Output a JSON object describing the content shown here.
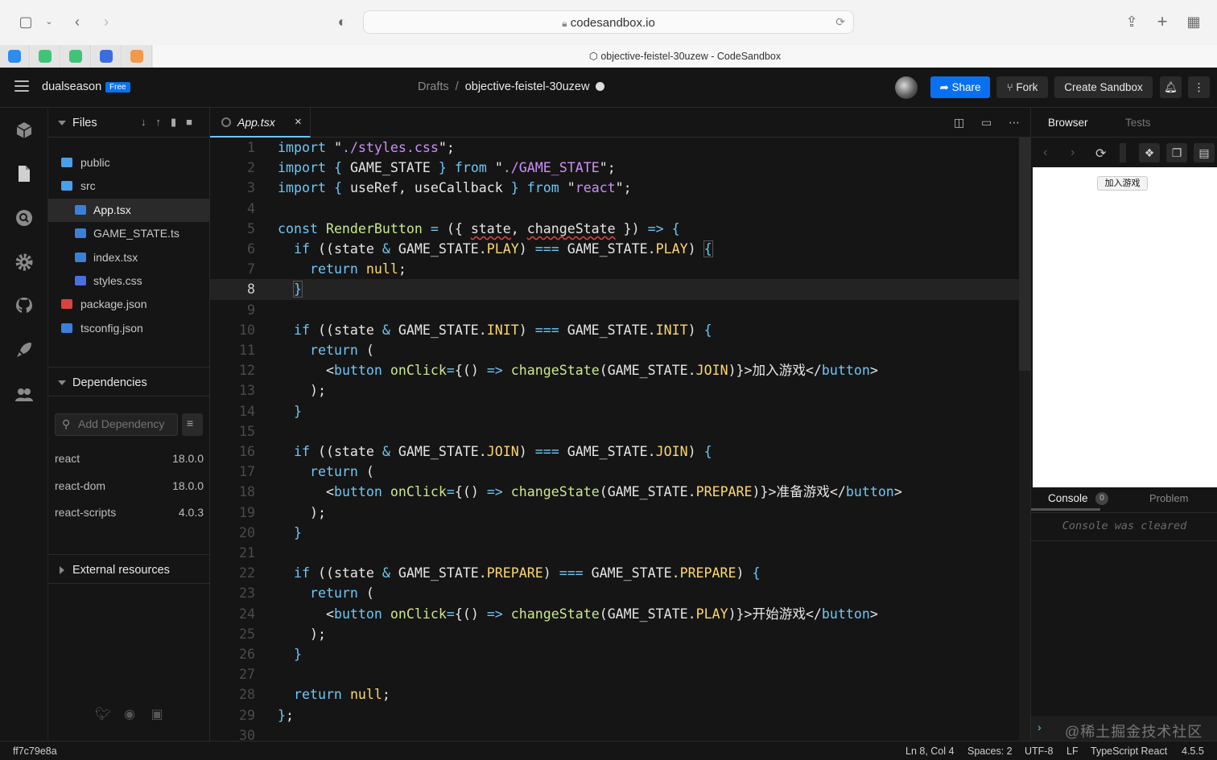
{
  "browser": {
    "url": "codesandbox.io",
    "tab_title": "objective-feistel-30uzew - CodeSandbox"
  },
  "header": {
    "username": "dualseason",
    "plan_badge": "Free",
    "breadcrumb_root": "Drafts",
    "breadcrumb_sep": "/",
    "sandbox_name": "objective-feistel-30uzew",
    "share_label": "Share",
    "fork_label": "Fork",
    "create_label": "Create Sandbox"
  },
  "sidebar": {
    "files_title": "Files",
    "files": [
      {
        "name": "public",
        "type": "folder",
        "indent": 0
      },
      {
        "name": "src",
        "type": "folder-open",
        "indent": 0
      },
      {
        "name": "App.tsx",
        "type": "ts",
        "indent": 1,
        "active": true
      },
      {
        "name": "GAME_STATE.ts",
        "type": "ts",
        "indent": 1
      },
      {
        "name": "index.tsx",
        "type": "ts",
        "indent": 1
      },
      {
        "name": "styles.css",
        "type": "css",
        "indent": 1
      },
      {
        "name": "package.json",
        "type": "npm",
        "indent": 0
      },
      {
        "name": "tsconfig.json",
        "type": "ts",
        "indent": 0
      }
    ],
    "dependencies_title": "Dependencies",
    "add_dependency_placeholder": "Add Dependency",
    "dependencies": [
      {
        "name": "react",
        "version": "18.0.0"
      },
      {
        "name": "react-dom",
        "version": "18.0.0"
      },
      {
        "name": "react-scripts",
        "version": "4.0.3"
      }
    ],
    "external_title": "External resources"
  },
  "editor": {
    "tab_name": "App.tsx",
    "tab_close": "×",
    "current_line": 8
  },
  "preview": {
    "tab_browser": "Browser",
    "tab_tests": "Tests",
    "preview_button": "加入游戏",
    "console_tab": "Console",
    "console_count": "0",
    "problems_tab": "Problem",
    "console_message": "Console was cleared",
    "prompt_glyph": "›",
    "watermark": "@稀土掘金技术社区"
  },
  "status": {
    "commit": "ff7c79e8a",
    "position": "Ln 8, Col 4",
    "spaces": "Spaces: 2",
    "encoding": "UTF-8",
    "eol": "LF",
    "language": "TypeScript React",
    "version": "4.5.5"
  },
  "colors": {
    "accent": "#0971f1",
    "keyword": "#6cc7f6",
    "property": "#fed86a",
    "function": "#c9e88b",
    "string_quoted": "#cf8ef7"
  }
}
